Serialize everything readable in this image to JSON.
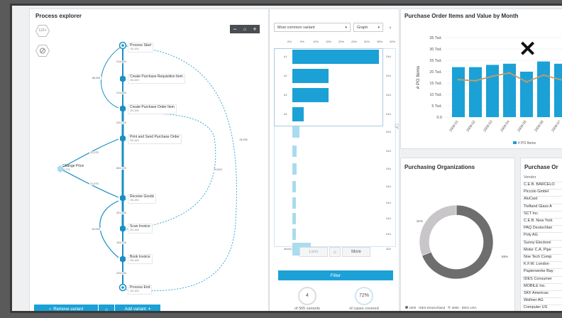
{
  "process_explorer": {
    "title": "Process explorer",
    "badge_top": "123+",
    "toolbar_minus": "−",
    "toolbar_plus": "+",
    "nodes": [
      {
        "label": "Process Start",
        "count": "251,893"
      },
      {
        "label": "Create Purchase Requisition Item",
        "count": "251,893"
      },
      {
        "label": "Create Purchase Order Item",
        "count": "251,893"
      },
      {
        "label": "Print and Send Purchase Order",
        "count": "251,893"
      },
      {
        "label": "Change Price",
        "count": "22,376"
      },
      {
        "label": "Receive Goods",
        "count": "251,893"
      },
      {
        "label": "Scan Invoice",
        "count": "251,893"
      },
      {
        "label": "Book Invoice",
        "count": "251,893"
      },
      {
        "label": "Process End",
        "count": "251,893"
      }
    ],
    "edges": [
      "214,850",
      "88,981",
      "214,850",
      "220,015",
      "22,075",
      "654,123",
      "21,075",
      "18,938",
      "251,893",
      "20,818",
      "153,378",
      "229,935",
      "78,938"
    ],
    "remove_variant": "Remove variant",
    "home_icon_label": "⌂",
    "add_variant": "Add variant"
  },
  "variants": {
    "dropdown": "Most common variant",
    "view": "Graph",
    "axis_ticks": [
      "0%",
      "5%",
      "10%",
      "15%",
      "20%",
      "25%",
      "30%",
      "35%",
      "40%"
    ],
    "rows": [
      {
        "label": "#1",
        "value": 38,
        "right": "24d"
      },
      {
        "label": "#2",
        "value": 16,
        "right": "24d"
      },
      {
        "label": "#3",
        "value": 16,
        "right": "24d"
      },
      {
        "label": "#4",
        "value": 5,
        "right": "24d"
      },
      {
        "label": "",
        "value": 3,
        "right": "24d"
      },
      {
        "label": "",
        "value": 2,
        "right": "24d"
      },
      {
        "label": "",
        "value": 2,
        "right": "24d"
      },
      {
        "label": "",
        "value": 1.5,
        "right": "24d"
      },
      {
        "label": "",
        "value": 1.5,
        "right": "24d"
      },
      {
        "label": "",
        "value": 1.5,
        "right": "24d"
      },
      {
        "label": "",
        "value": 1.5,
        "right": "24d"
      },
      {
        "label": "others",
        "value": 8,
        "right": "32d"
      }
    ],
    "less_btn": "Less",
    "more_btn": "More",
    "filter_btn": "Filter",
    "stat1_value": "4",
    "stat1_label": "of 565 variants",
    "stat2_value": "72%",
    "stat2_label": "of cases covered"
  },
  "po_chart": {
    "title": "Purchase Order Items and Value by Month",
    "close_icon": "✕",
    "legend": "# PO Items",
    "ylabel": "# PO Items"
  },
  "chart_data": {
    "type": "bar",
    "title": "Purchase Order Items and Value by Month",
    "ylabel": "# PO Items",
    "ytick_labels": [
      "0.0",
      "5 Tsd.",
      "10 Tsd.",
      "15 Tsd.",
      "20 Tsd.",
      "25 Tsd.",
      "30 Tsd.",
      "35 Tsd."
    ],
    "ylim": [
      0,
      35000
    ],
    "categories": [
      "2009-01",
      "2009-02",
      "2009-03",
      "2009-04",
      "2009-05",
      "2009-06",
      "2009-07"
    ],
    "series": [
      {
        "name": "# PO Items",
        "type": "bar",
        "values": [
          22000,
          22000,
          23000,
          23500,
          20000,
          24500,
          23500
        ]
      },
      {
        "type": "line",
        "values": [
          16500,
          16000,
          18000,
          19500,
          15500,
          18500,
          16500
        ]
      }
    ],
    "colors": {
      "bar": "#1ba1d6",
      "line": "#c89a6a"
    }
  },
  "purch_orgs": {
    "title": "Purchasing Organizations",
    "pct_left": "31%",
    "pct_right": "69%",
    "slices": [
      0.69,
      0.31
    ],
    "colors": [
      "#6e6e6e",
      "#c9c6c9"
    ],
    "legend": [
      "1000 · IDES Deutschland",
      "3000 · IDES USA"
    ]
  },
  "vendors": {
    "title": "Purchase Or",
    "header": "Vendor",
    "rows": [
      "C.E.B. BARCELO",
      "Piccolo GmbH",
      "AluCast",
      "Tiefland Glass A",
      "SCT Inc.",
      "C.E.B. New York",
      "PAQ Deutschlan",
      "Poly AG",
      "Sunny Electroni",
      "Motor C.A. Pipe",
      "Noe Tech Comp",
      "K.F.W. London",
      "Papierwerke Bay",
      "IDES Consumer",
      "MOBILE Inc.",
      "SKF Americas",
      "Wollner AG",
      "Computer US"
    ]
  }
}
